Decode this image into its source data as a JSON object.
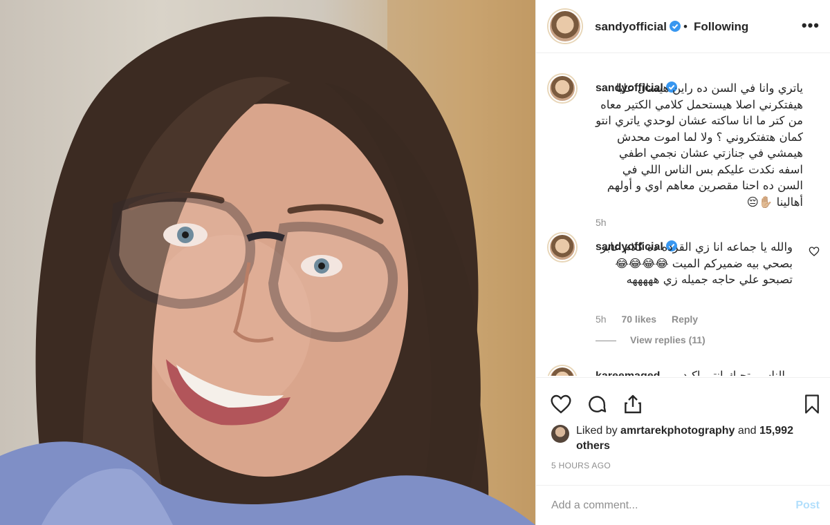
{
  "post": {
    "username": "sandyofficial",
    "follow_separator": "•",
    "follow_label": "Following",
    "more_label": "•••",
    "icons": [
      "verified-badge-icon",
      "more-options-icon",
      "heart-icon",
      "comment-icon",
      "share-icon",
      "bookmark-icon"
    ]
  },
  "caption": {
    "username": "sandyofficial",
    "text": "ياتري وانا في السن ده راين هيسال عليا هيفتكرني اصلا هيستحمل كلامي الكتير معاه من كتر ما انا ساكته عشان لوحدي ياتري انتو كمان هتفتكروني ؟ ولا لما اموت محدش هيمشي في جنازتي عشان نجمي اطفي اسفه نكدت عليكم بس الناس اللي في السن ده احنا مقصرين معاهم اوي و أولهم أهالينا ✋🏼😔",
    "time": "5h"
  },
  "reply": {
    "username": "sandyofficial",
    "text": "والله يا جماعه انا زي القرده ده كلام عابر بصحي بيه ضميركم الميت 😂😂😂😂 تصبحو علي حاجه جميله زي هههههه",
    "time": "5h",
    "likes": "70 likes",
    "reply_label": "Reply",
    "view_replies": "View replies (11)"
  },
  "partial_comment": {
    "username": "kareemaged",
    "text": "الناس بتحبك انتي اكيد"
  },
  "likes": {
    "prefix": "Liked by",
    "user": "amrtarekphotography",
    "and": "and",
    "others": "15,992 others"
  },
  "timestamp": "5 HOURS AGO",
  "composer": {
    "placeholder": "Add a comment...",
    "post_label": "Post"
  },
  "colors": {
    "verified": "#3897f0",
    "post_disabled": "#b2dffc",
    "meta_gray": "#8e8e8e"
  }
}
